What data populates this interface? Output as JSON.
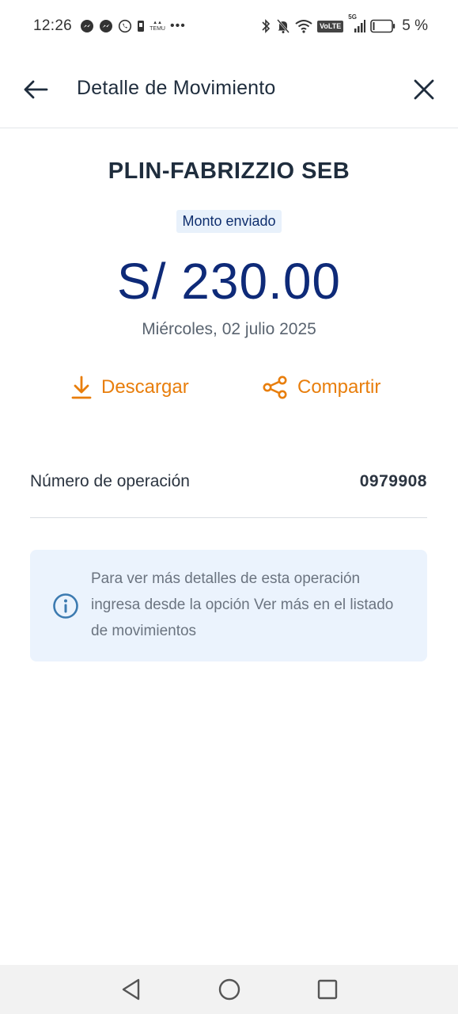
{
  "status_bar": {
    "time": "12:26",
    "left_icons": [
      "messenger-icon",
      "messenger-icon",
      "whatsapp-icon",
      "sim-icon",
      "temu-icon",
      "more-dots-icon"
    ],
    "temu_text": "TEMU",
    "volte": "VoLTE",
    "network": "5G",
    "battery_percent": "5 %"
  },
  "header": {
    "title": "Detalle de Movimiento",
    "back_icon": "arrow-left-icon",
    "close_icon": "close-icon"
  },
  "transaction": {
    "recipient": "PLIN-FABRIZZIO SEB",
    "amount_tag": "Monto enviado",
    "amount": "S/ 230.00",
    "date": "Miércoles, 02 julio 2025"
  },
  "actions": {
    "download_label": "Descargar",
    "share_label": "Compartir"
  },
  "details": {
    "operation_label": "Número de operación",
    "operation_value": "0979908"
  },
  "info": {
    "text": "Para ver más detalles de esta operación ingresa desde la opción Ver más en el listado de movimientos"
  },
  "colors": {
    "accent_orange": "#e87e0c",
    "amount_blue": "#0e2a78",
    "info_bg": "#ebf3fd",
    "info_icon": "#3c7ab0"
  }
}
